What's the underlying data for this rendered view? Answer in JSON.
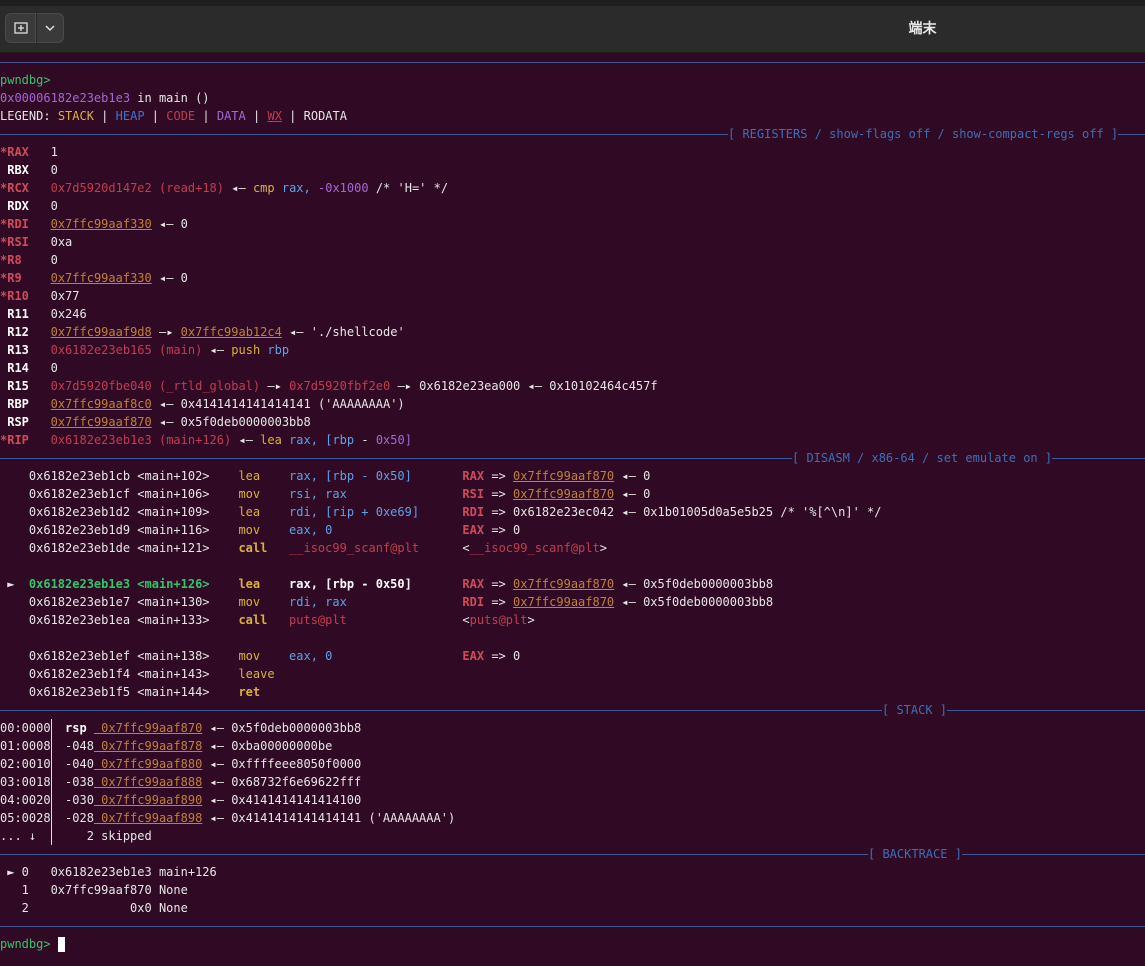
{
  "window": {
    "title": "端末"
  },
  "terminal": {
    "prompt": "pwndbg>",
    "frame_addr": "0x00006182e23eb1e3",
    "frame_func": "in main ()",
    "legend": {
      "label": "LEGEND:",
      "items": [
        "STACK",
        "HEAP",
        "CODE",
        "DATA",
        "WX",
        "RODATA"
      ]
    },
    "headers": {
      "registers": "[ REGISTERS / show-flags off / show-compact-regs off ]",
      "disasm": "[ DISASM / x86-64 / set emulate on ]",
      "stack": "[ STACK ]",
      "backtrace": "[ BACKTRACE ]"
    },
    "registers": [
      {
        "mark": "*",
        "name": "RAX",
        "val": "1"
      },
      {
        "mark": " ",
        "name": "RBX",
        "val": "0"
      },
      {
        "mark": "*",
        "name": "RCX",
        "val": "0x7d5920d147e2 (read+18) ◂— cmp rax, -0x1000 /* 'H=' */"
      },
      {
        "mark": " ",
        "name": "RDX",
        "val": "0"
      },
      {
        "mark": "*",
        "name": "RDI",
        "val": "0x7ffc99aaf330 ◂— 0"
      },
      {
        "mark": "*",
        "name": "RSI",
        "val": "0xa"
      },
      {
        "mark": "*",
        "name": "R8",
        "val": "0"
      },
      {
        "mark": "*",
        "name": "R9",
        "val": "0x7ffc99aaf330 ◂— 0"
      },
      {
        "mark": "*",
        "name": "R10",
        "val": "0x77"
      },
      {
        "mark": " ",
        "name": "R11",
        "val": "0x246"
      },
      {
        "mark": " ",
        "name": "R12",
        "val": "0x7ffc99aaf9d8 —▸ 0x7ffc99ab12c4 ◂— './shellcode'"
      },
      {
        "mark": " ",
        "name": "R13",
        "val": "0x6182e23eb165 (main) ◂— push rbp"
      },
      {
        "mark": " ",
        "name": "R14",
        "val": "0"
      },
      {
        "mark": " ",
        "name": "R15",
        "val": "0x7d5920fbe040 (_rtld_global) —▸ 0x7d5920fbf2e0 —▸ 0x6182e23ea000 ◂— 0x10102464c457f"
      },
      {
        "mark": " ",
        "name": "RBP",
        "val": "0x7ffc99aaf8c0 ◂— 0x4141414141414141 ('AAAAAAAA')"
      },
      {
        "mark": " ",
        "name": "RSP",
        "val": "0x7ffc99aaf870 ◂— 0x5f0deb0000003bb8"
      },
      {
        "mark": "*",
        "name": "RIP",
        "val": "0x6182e23eb1e3 (main+126) ◂— lea rax, [rbp - 0x50]"
      }
    ],
    "disasm": [
      {
        "addr": "0x6182e23eb1cb",
        "sym": "<main+102>",
        "op": "lea",
        "args": "rax, [rbp - 0x50]",
        "note": "RAX => 0x7ffc99aaf870 ◂— 0"
      },
      {
        "addr": "0x6182e23eb1cf",
        "sym": "<main+106>",
        "op": "mov",
        "args": "rsi, rax",
        "note": "RSI => 0x7ffc99aaf870 ◂— 0"
      },
      {
        "addr": "0x6182e23eb1d2",
        "sym": "<main+109>",
        "op": "lea",
        "args": "rdi, [rip + 0xe69]",
        "note": "RDI => 0x6182e23ec042 ◂— 0x1b01005d0a5e5b25 /* '%[^\\n]' */"
      },
      {
        "addr": "0x6182e23eb1d9",
        "sym": "<main+116>",
        "op": "mov",
        "args": "eax, 0",
        "note": "EAX => 0"
      },
      {
        "addr": "0x6182e23eb1de",
        "sym": "<main+121>",
        "op": "call",
        "args": "__isoc99_scanf@plt",
        "note": "<__isoc99_scanf@plt>"
      },
      {
        "addr": "0x6182e23eb1e3",
        "sym": "<main+126>",
        "op": "lea",
        "args": "rax, [rbp - 0x50]",
        "note": "RAX => 0x7ffc99aaf870 ◂— 0x5f0deb0000003bb8",
        "current": "►"
      },
      {
        "addr": "0x6182e23eb1e7",
        "sym": "<main+130>",
        "op": "mov",
        "args": "rdi, rax",
        "note": "RDI => 0x7ffc99aaf870 ◂— 0x5f0deb0000003bb8"
      },
      {
        "addr": "0x6182e23eb1ea",
        "sym": "<main+133>",
        "op": "call",
        "args": "puts@plt",
        "note": "<puts@plt>"
      },
      {
        "addr": "0x6182e23eb1ef",
        "sym": "<main+138>",
        "op": "mov",
        "args": "eax, 0",
        "note": "EAX => 0"
      },
      {
        "addr": "0x6182e23eb1f4",
        "sym": "<main+143>",
        "op": "leave",
        "args": "",
        "note": ""
      },
      {
        "addr": "0x6182e23eb1f5",
        "sym": "<main+144>",
        "op": "ret",
        "args": "",
        "note": ""
      }
    ],
    "stack": [
      {
        "idx": "00:0000",
        "off": "rsp",
        "addr": "0x7ffc99aaf870",
        "val": "◂— 0x5f0deb0000003bb8"
      },
      {
        "idx": "01:0008",
        "off": "-048",
        "addr": "0x7ffc99aaf878",
        "val": "◂— 0xba00000000be"
      },
      {
        "idx": "02:0010",
        "off": "-040",
        "addr": "0x7ffc99aaf880",
        "val": "◂— 0xffffeee8050f0000"
      },
      {
        "idx": "03:0018",
        "off": "-038",
        "addr": "0x7ffc99aaf888",
        "val": "◂— 0x68732f6e69622fff"
      },
      {
        "idx": "04:0020",
        "off": "-030",
        "addr": "0x7ffc99aaf890",
        "val": "◂— 0x4141414141414100"
      },
      {
        "idx": "05:0028",
        "off": "-028",
        "addr": "0x7ffc99aaf898",
        "val": "◂— 0x4141414141414141 ('AAAAAAAA')"
      }
    ],
    "stack_skip": {
      "arrow": "... ↓",
      "text": "2 skipped"
    },
    "backtrace": [
      {
        "mark": "►",
        "n": "0",
        "addr": "0x6182e23eb1e3",
        "sym": "main+126"
      },
      {
        "mark": " ",
        "n": "1",
        "addr": "0x7ffc99aaf870",
        "sym": "None"
      },
      {
        "mark": " ",
        "n": "2",
        "addr": "0x0",
        "sym": "None"
      }
    ]
  }
}
